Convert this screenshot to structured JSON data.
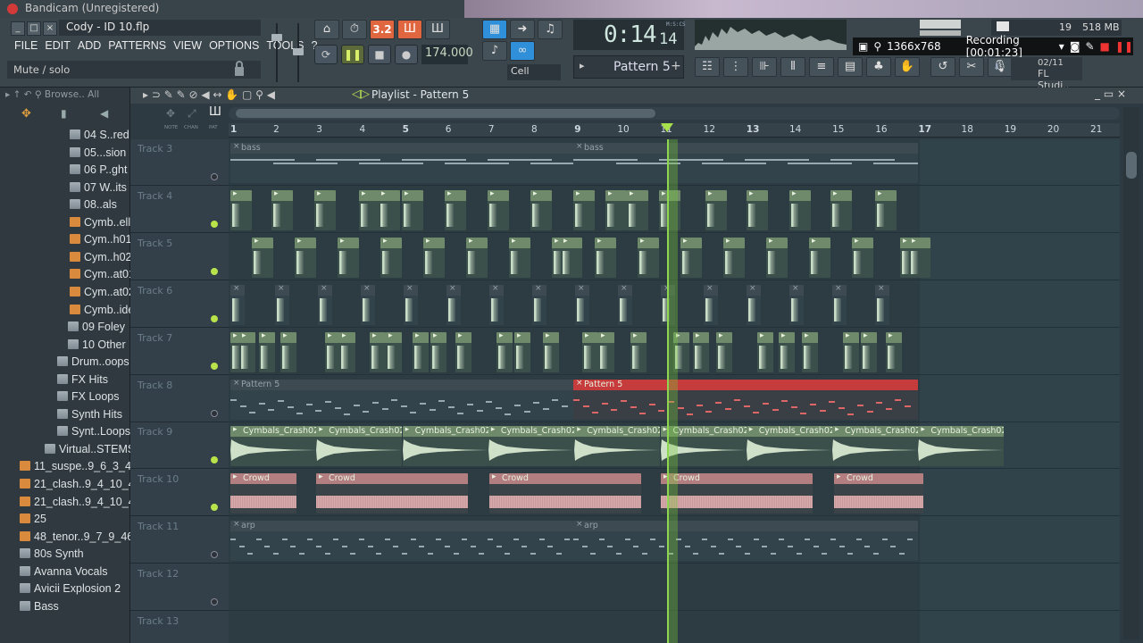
{
  "bandicam": {
    "title": "Bandicam (Unregistered)",
    "resolution": "1366x768",
    "recording_label": "Recording [00:01:23]"
  },
  "project": {
    "title": "Cody - ID 10.flp"
  },
  "menu": [
    "FILE",
    "EDIT",
    "ADD",
    "PATTERNS",
    "VIEW",
    "OPTIONS",
    "TOOLS",
    "?"
  ],
  "hint": "Mute / solo",
  "transport": {
    "tempo": "174.000",
    "time": "0:14",
    "time_sub": "14",
    "time_unit": "M:S:CS",
    "pattern": "Pattern 5",
    "snap": "Cell",
    "tempo_digits": "3.2"
  },
  "cpu": {
    "voices": "19",
    "memory": "518 MB"
  },
  "version": {
    "date": "02/11",
    "name": "FL Studi.."
  },
  "browser": {
    "label": "Browse.. All"
  },
  "tree": [
    {
      "label": "04 S..red",
      "type": "folder"
    },
    {
      "label": "05...sion",
      "type": "folder"
    },
    {
      "label": "06 P..ght",
      "type": "folder"
    },
    {
      "label": "07 W..its",
      "type": "folder"
    },
    {
      "label": "08..als",
      "type": "folder"
    },
    {
      "label": "Cymb..ell",
      "type": "sample"
    },
    {
      "label": "Cym..h01",
      "type": "sample"
    },
    {
      "label": "Cym..h02",
      "type": "sample"
    },
    {
      "label": "Cym..at01",
      "type": "sample"
    },
    {
      "label": "Cym..at02",
      "type": "sample"
    },
    {
      "label": "Cymb..ide",
      "type": "sample"
    },
    {
      "label": "09 Foley",
      "type": "folder"
    },
    {
      "label": "10 Other",
      "type": "folder"
    },
    {
      "label": "Drum..oops",
      "type": "folder"
    },
    {
      "label": "FX Hits",
      "type": "folder"
    },
    {
      "label": "FX Loops",
      "type": "folder"
    },
    {
      "label": "Synth Hits",
      "type": "folder"
    },
    {
      "label": "Synt..Loops",
      "type": "folder"
    },
    {
      "label": "Virtual..STEMS",
      "type": "folder"
    },
    {
      "label": "11_suspe..9_6_3_49",
      "type": "sample"
    },
    {
      "label": "21_clash..9_4_10_40",
      "type": "sample"
    },
    {
      "label": "21_clash..9_4_10_40",
      "type": "sample"
    },
    {
      "label": "25",
      "type": "sample"
    },
    {
      "label": "48_tenor..9_7_9_46",
      "type": "sample"
    },
    {
      "label": "80s Synth",
      "type": "folder"
    },
    {
      "label": "Avanna Vocals",
      "type": "folder"
    },
    {
      "label": "Avicii Explosion 2",
      "type": "folder"
    },
    {
      "label": "Bass",
      "type": "folder"
    }
  ],
  "playlist": {
    "title": "Playlist - Pattern 5",
    "header_labels": [
      "NOTE",
      "CHAN",
      "PAT"
    ],
    "bars": [
      "1",
      "2",
      "3",
      "4",
      "5",
      "6",
      "7",
      "8",
      "9",
      "10",
      "11",
      "12",
      "13",
      "14",
      "15",
      "16",
      "17",
      "18",
      "19",
      "20",
      "21"
    ],
    "tracks": [
      {
        "name": "Track 3",
        "led": false
      },
      {
        "name": "Track 4",
        "led": true
      },
      {
        "name": "Track 5",
        "led": true
      },
      {
        "name": "Track 6",
        "led": true
      },
      {
        "name": "Track 7",
        "led": true
      },
      {
        "name": "Track 8",
        "led": false
      },
      {
        "name": "Track 9",
        "led": true
      },
      {
        "name": "Track 10",
        "led": true
      },
      {
        "name": "Track 11",
        "led": false
      },
      {
        "name": "Track 12",
        "led": false
      },
      {
        "name": "Track 13",
        "led": false
      }
    ],
    "clips": {
      "bass": "bass",
      "pattern5": "Pattern 5",
      "crash": "Cymbals_Crash02",
      "crowd": "Crowd",
      "arp": "arp"
    }
  },
  "colors": {
    "accent": "#a6e04a",
    "record": "#d23a3a",
    "pattern_red": "#c63b3b",
    "clip_green": "#6e8a6a",
    "clip_pink": "#b27e80"
  }
}
